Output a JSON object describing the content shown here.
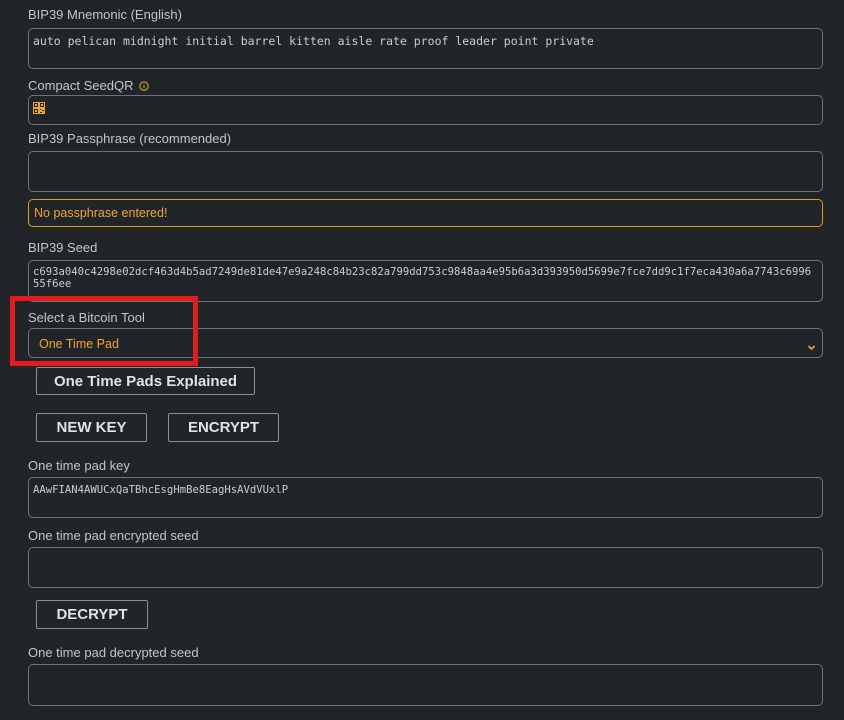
{
  "mnemonic": {
    "label": "BIP39 Mnemonic (English)",
    "value": "auto pelican midnight initial barrel kitten aisle rate proof leader point private"
  },
  "compact_seedqr": {
    "label": "Compact SeedQR",
    "info_icon": "info-circle-icon",
    "qr_icon": "qr-code-icon"
  },
  "passphrase": {
    "label": "BIP39 Passphrase (recommended)",
    "value": "",
    "warning": "No passphrase entered!"
  },
  "seed": {
    "label": "BIP39 Seed",
    "value": "c693a040c4298e02dcf463d4b5ad7249de81de47e9a248c84b23c82a799dd753c9848aa4e95b6a3d393950d5699e7fce7dd9c1f7eca430a6a7743c699655f6ee"
  },
  "tool_select": {
    "label": "Select a Bitcoin Tool",
    "selected": "One Time Pad"
  },
  "buttons": {
    "explained": "One Time Pads Explained",
    "new_key": "NEW KEY",
    "encrypt": "ENCRYPT",
    "decrypt": "DECRYPT"
  },
  "otp_key": {
    "label": "One time pad key",
    "value": "AAwFIAN4AWUCxQaTBhcEsgHmBe8EagHsAVdVUxlP"
  },
  "otp_encrypted": {
    "label": "One time pad encrypted seed",
    "value": ""
  },
  "otp_decrypted": {
    "label": "One time pad decrypted seed",
    "value": ""
  },
  "colors": {
    "background": "#212529",
    "accent_orange": "#f0a62a",
    "highlight_red": "#e21b1b",
    "border": "#6c737b"
  }
}
